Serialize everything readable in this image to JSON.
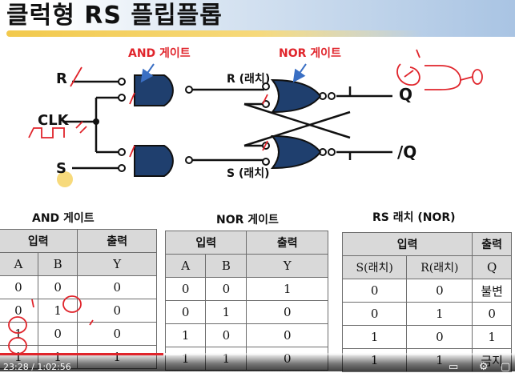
{
  "title": "클럭형 RS 플립플롭",
  "circuit": {
    "and_gate_label": "AND 게이트",
    "nor_gate_label": "NOR 게이트",
    "input_r": "R",
    "input_clk": "CLK",
    "input_s": "S",
    "r_latch": "R (래치)",
    "s_latch": "S (래치)",
    "output_q": "Q",
    "output_qbar": "/Q"
  },
  "and_table": {
    "title": "AND 게이트",
    "group_headers": [
      "입력",
      "출력"
    ],
    "columns": [
      "A",
      "B",
      "Y"
    ],
    "rows": [
      [
        "0",
        "0",
        "0"
      ],
      [
        "0",
        "1",
        "0"
      ],
      [
        "1",
        "0",
        "0"
      ],
      [
        "1",
        "1",
        "1"
      ]
    ]
  },
  "nor_table": {
    "title": "NOR 게이트",
    "group_headers": [
      "입력",
      "출력"
    ],
    "columns": [
      "A",
      "B",
      "Y"
    ],
    "rows": [
      [
        "0",
        "0",
        "1"
      ],
      [
        "0",
        "1",
        "0"
      ],
      [
        "1",
        "0",
        "0"
      ],
      [
        "1",
        "1",
        "0"
      ]
    ]
  },
  "rs_table": {
    "title": "RS 래치 (NOR)",
    "group_headers": [
      "입력",
      "출력"
    ],
    "columns": [
      "S(래치)",
      "R(래치)",
      "Q"
    ],
    "rows": [
      [
        "0",
        "0",
        "불변"
      ],
      [
        "0",
        "1",
        "0"
      ],
      [
        "1",
        "0",
        "1"
      ],
      [
        "1",
        "1",
        "금지"
      ]
    ]
  },
  "player": {
    "time": "23:28 / 1:02:56",
    "progress": 0.318,
    "buffered": 0.36
  },
  "colors": {
    "gate_fill": "#1f3f6e",
    "annotation_red": "#e0242b",
    "table_header": "#d9d9d9",
    "progress_red": "#e0242b"
  }
}
